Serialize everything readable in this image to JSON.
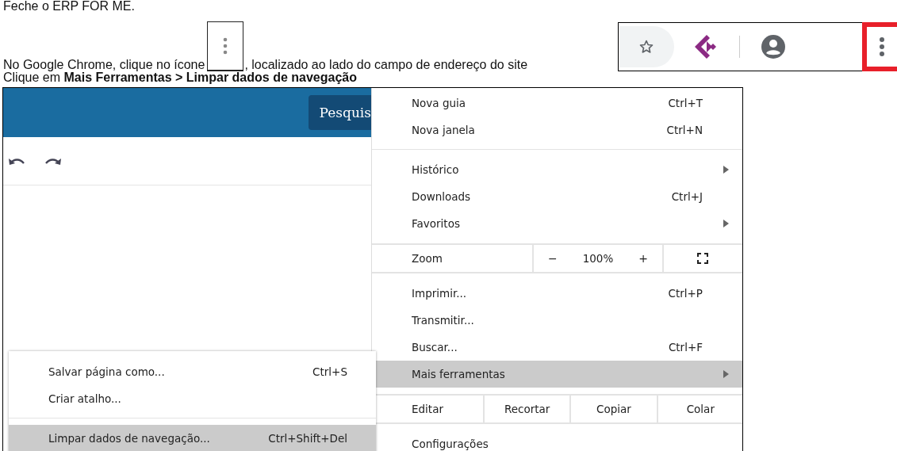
{
  "intro": {
    "text": "Feche o ERP FOR ME."
  },
  "instruction": {
    "before": "No Google Chrome, clique no ícone",
    "after": ", localizado ao lado do campo de endereço do site"
  },
  "step": {
    "text": "Clique em **Mais Ferramentas > Limpar dados de navegação**"
  },
  "browser_page": {
    "search_button": "Pesquis"
  },
  "menu": {
    "items": [
      {
        "kind": "item",
        "label": "Nova guia",
        "shortcut": "Ctrl+T",
        "selected": false
      },
      {
        "kind": "item",
        "label": "Nova janela",
        "shortcut": "Ctrl+N",
        "selected": false
      },
      {
        "kind": "separator"
      },
      {
        "kind": "submenu",
        "label": "Histórico",
        "selected": false
      },
      {
        "kind": "item",
        "label": "Downloads",
        "shortcut": "Ctrl+J",
        "selected": false
      },
      {
        "kind": "submenu",
        "label": "Favoritos",
        "selected": false
      },
      {
        "kind": "zoom",
        "label": "Zoom",
        "minus": "−",
        "value": "100%",
        "plus": "+"
      },
      {
        "kind": "item",
        "label": "Imprimir...",
        "shortcut": "Ctrl+P",
        "selected": false
      },
      {
        "kind": "item",
        "label": "Transmitir...",
        "selected": false
      },
      {
        "kind": "item",
        "label": "Buscar...",
        "shortcut": "Ctrl+F",
        "selected": false
      },
      {
        "kind": "submenu",
        "label": "Mais ferramentas",
        "selected": true
      },
      {
        "kind": "edit",
        "label": "Editar",
        "actions": [
          "Recortar",
          "Copiar",
          "Colar"
        ]
      },
      {
        "kind": "item",
        "label": "Configurações",
        "selected": false
      }
    ]
  },
  "submenu": {
    "items": [
      {
        "kind": "item",
        "label": "Salvar página como...",
        "shortcut": "Ctrl+S",
        "selected": false
      },
      {
        "kind": "item",
        "label": "Criar atalho...",
        "selected": false
      },
      {
        "kind": "separator"
      },
      {
        "kind": "item",
        "label": "Limpar dados de navegação...",
        "shortcut": "Ctrl+Shift+Del",
        "selected": true
      }
    ]
  }
}
